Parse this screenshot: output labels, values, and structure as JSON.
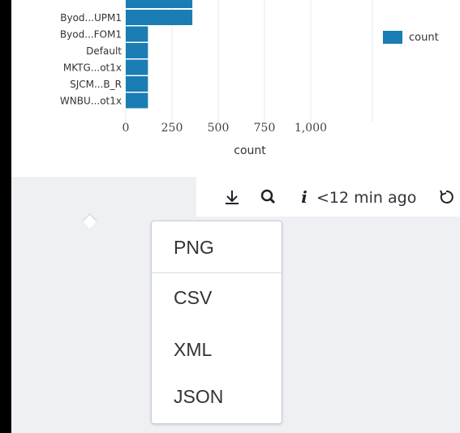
{
  "chart_data": {
    "type": "bar",
    "orientation": "horizontal",
    "categories": [
      "Byod...UPM1",
      "Byod...FOM1",
      "Default",
      "MKTG...ot1x",
      "SJCM...B_R",
      "WNBU...ot1x"
    ],
    "series": [
      {
        "name": "count",
        "values": [
          360,
          120,
          120,
          120,
          120,
          120
        ]
      }
    ],
    "xlabel": "count",
    "xticks": [
      "0",
      "250",
      "500",
      "750",
      "1,000"
    ],
    "xlim": [
      0,
      1000
    ],
    "legend_position": "right",
    "color": "#1a7db3"
  },
  "toolbar": {
    "download_icon": "download-icon",
    "search_icon": "search-icon",
    "info_icon": "info-icon",
    "timestamp": "<12 min ago",
    "refresh_icon": "refresh-icon"
  },
  "export_menu": {
    "items": [
      "PNG",
      "CSV",
      "XML",
      "JSON"
    ]
  }
}
